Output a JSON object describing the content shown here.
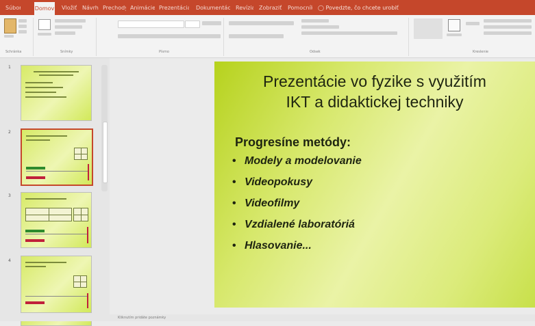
{
  "ribbon_tabs": [
    "Súbor",
    "Domov",
    "Vložiť",
    "Návrh",
    "Prechody",
    "Animácie",
    "Prezentácia",
    "Dokumentácia",
    "Revízia",
    "Zobraziť",
    "Pomocník"
  ],
  "tell_me": "Povedzte, čo chcete urobiť",
  "groups": [
    "Schránka",
    "Snímky",
    "Písmo",
    "Odsek",
    "Kreslenie"
  ],
  "thumbnails": [
    {
      "num": "1"
    },
    {
      "num": "2"
    },
    {
      "num": "3"
    },
    {
      "num": "4"
    }
  ],
  "slide": {
    "title_line1": "Prezentácie vo fyzike s využitím",
    "title_line2": "IKT a didaktickej techniky",
    "subtitle": "Progresíne metódy:",
    "bullets": [
      "Modely a modelovanie",
      "Videopokusy",
      "Videofilmy",
      "Vzdialené laboratóriá",
      "Hlasovanie..."
    ]
  },
  "status": {
    "notes_hint": "Kliknutím pridáte poznámky"
  },
  "colors": {
    "accent": "#c5472b",
    "slide_green": "#b6d21d"
  }
}
